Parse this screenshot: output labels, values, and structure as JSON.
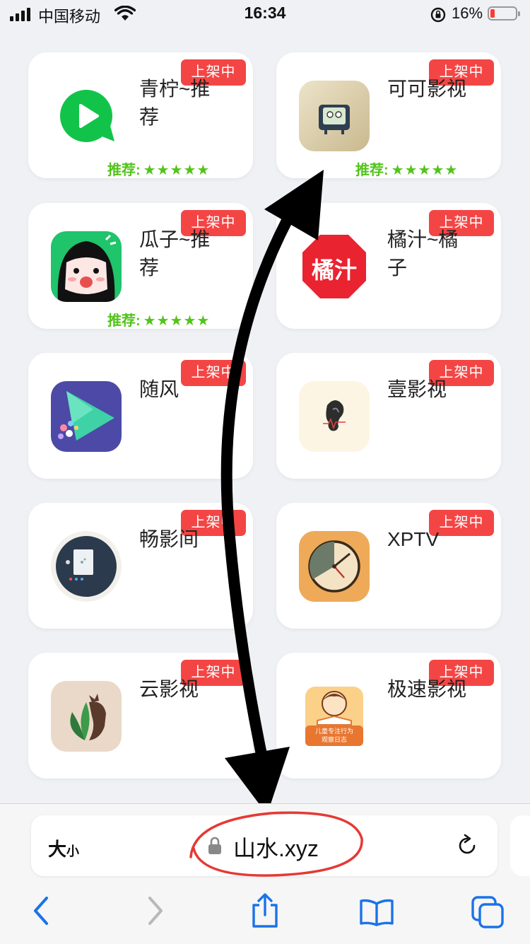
{
  "status_bar": {
    "carrier": "中国移动",
    "time": "16:34",
    "battery_percent": "16%",
    "battery_level": 0.16,
    "battery_color": "#ff3b30"
  },
  "apps": [
    {
      "name": "青柠~推荐",
      "status": "上架中",
      "rating_label": "推荐:",
      "stars": "★★★★★",
      "icon": "green-play-icon"
    },
    {
      "name": "可可影视",
      "status": "上架中",
      "rating_label": "推荐:",
      "stars": "★★★★★",
      "icon": "tv-mascot-icon"
    },
    {
      "name": "瓜子~推荐",
      "status": "上架中",
      "rating_label": "推荐:",
      "stars": "★★★★★",
      "icon": "cartoon-face-icon"
    },
    {
      "name": "橘汁~橘子",
      "status": "上架中",
      "icon": "juzhi-logo-icon",
      "icon_text": "橘汁"
    },
    {
      "name": "随风",
      "status": "上架中",
      "icon": "gradient-play-icon"
    },
    {
      "name": "壹影视",
      "status": "上架中",
      "icon": "ear-icon"
    },
    {
      "name": "畅影间",
      "status": "上架中",
      "icon": "projector-icon"
    },
    {
      "name": "XPTV",
      "status": "上架中",
      "icon": "clock-icon"
    },
    {
      "name": "云影视",
      "status": "上架中",
      "icon": "leaf-deer-icon"
    },
    {
      "name": "极速影视",
      "status": "上架中",
      "icon": "child-reading-icon",
      "icon_text_1": "儿童专注行为",
      "icon_text_2": "观察日志"
    }
  ],
  "browser": {
    "text_size_big": "大",
    "text_size_small": "小",
    "url": "山水.xyz",
    "accent_color": "#1a73e8"
  },
  "colors": {
    "badge": "#f44545",
    "rating": "#52c41a",
    "annotation_red": "#e53935"
  }
}
